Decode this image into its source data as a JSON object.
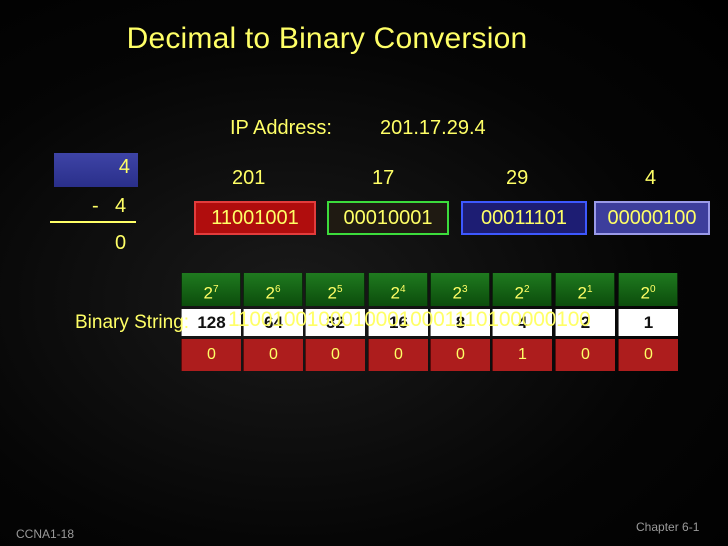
{
  "title": "Decimal to Binary Conversion",
  "ip": {
    "label": "IP Address:",
    "value": "201.17.29.4"
  },
  "subtraction": {
    "minuend": "4",
    "minus_sign": "-",
    "subtrahend": "4",
    "result": "0"
  },
  "octets": [
    {
      "decimal": "201",
      "binary": "11001001",
      "color": "#b00d0d"
    },
    {
      "decimal": "17",
      "binary": "00010001",
      "color": "#3cdc3c"
    },
    {
      "decimal": "29",
      "binary": "00011101",
      "color": "#3d58ff"
    },
    {
      "decimal": "4",
      "binary": "00000100",
      "color": "#3d3e9c"
    }
  ],
  "table": {
    "powers": [
      {
        "base": "2",
        "exp": "7"
      },
      {
        "base": "2",
        "exp": "6"
      },
      {
        "base": "2",
        "exp": "5"
      },
      {
        "base": "2",
        "exp": "4"
      },
      {
        "base": "2",
        "exp": "3"
      },
      {
        "base": "2",
        "exp": "2"
      },
      {
        "base": "2",
        "exp": "1"
      },
      {
        "base": "2",
        "exp": "0"
      }
    ],
    "places": [
      "128",
      "64",
      "32",
      "16",
      "8",
      "4",
      "2",
      "1"
    ],
    "bits": [
      "0",
      "0",
      "0",
      "0",
      "0",
      "1",
      "0",
      "0"
    ]
  },
  "binary_string": {
    "label": "Binary String:",
    "value": "11001001000100010001110100000100"
  },
  "footer": {
    "left": "CCNA1-18",
    "right": "Chapter 6-1"
  }
}
